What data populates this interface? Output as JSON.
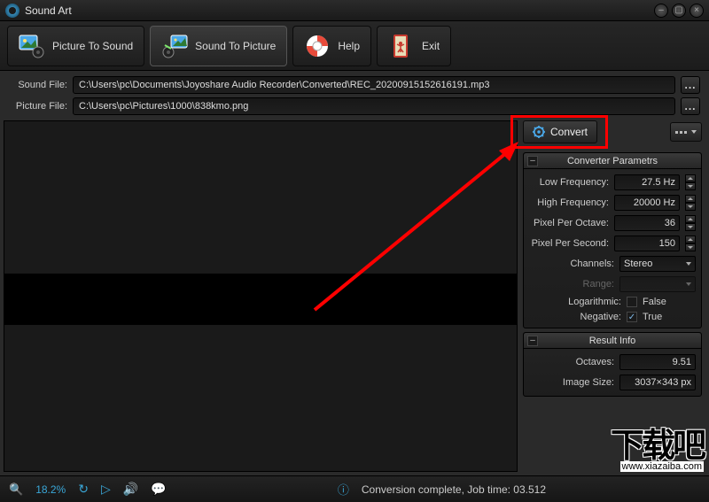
{
  "titlebar": {
    "title": "Sound Art"
  },
  "toolbar": {
    "picture_to_sound": "Picture To Sound",
    "sound_to_picture": "Sound To Picture",
    "help": "Help",
    "exit": "Exit"
  },
  "paths": {
    "sound_label": "Sound File:",
    "sound_value": "C:\\Users\\pc\\Documents\\Joyoshare Audio Recorder\\Converted\\REC_20200915152616191.mp3",
    "picture_label": "Picture File:",
    "picture_value": "C:\\Users\\pc\\Pictures\\1000\\838kmo.png"
  },
  "convert": {
    "label": "Convert"
  },
  "params": {
    "header": "Converter Parametrs",
    "low_freq_label": "Low Frequency:",
    "low_freq_value": "27.5 Hz",
    "high_freq_label": "High Frequency:",
    "high_freq_value": "20000 Hz",
    "pixel_octave_label": "Pixel Per Octave:",
    "pixel_octave_value": "36",
    "pixel_second_label": "Pixel Per Second:",
    "pixel_second_value": "150",
    "channels_label": "Channels:",
    "channels_value": "Stereo",
    "range_label": "Range:",
    "range_value": "",
    "logarithmic_label": "Logarithmic:",
    "logarithmic_value": "False",
    "negative_label": "Negative:",
    "negative_value": "True"
  },
  "result": {
    "header": "Result Info",
    "octaves_label": "Octaves:",
    "octaves_value": "9.51",
    "image_size_label": "Image Size:",
    "image_size_value": "3037×343 px"
  },
  "statusbar": {
    "zoom": "18.2%",
    "status": "Conversion complete, Job time: 03.512"
  },
  "watermark": {
    "big": "下载吧",
    "small": "www.xiazaiba.com"
  }
}
